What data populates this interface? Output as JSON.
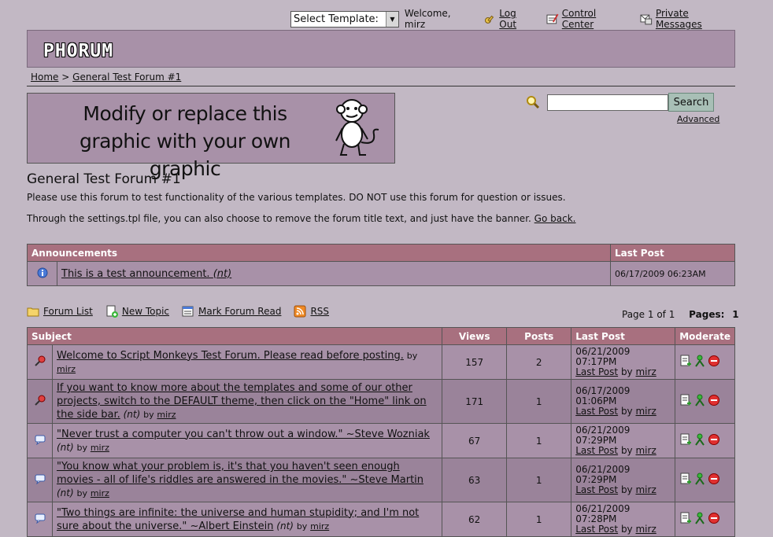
{
  "userbar": {
    "template_select": "Select Template:",
    "welcome": "Welcome, mirz",
    "logout": "Log Out",
    "control_center": "Control Center",
    "private_messages": "Private Messages"
  },
  "header": {
    "logo": "PHORUM"
  },
  "breadcrumb": {
    "home": "Home",
    "sep": ">",
    "forum": "General Test Forum #1"
  },
  "banner": {
    "line1": "Modify or replace this",
    "line2": "graphic with your own graphic"
  },
  "search": {
    "button": "Search",
    "advanced": "Advanced",
    "value": ""
  },
  "forum": {
    "title": "General Test Forum #1",
    "description": "Please use this forum to test functionality of the various templates. DO NOT use this forum for question or issues.",
    "note": "Through the settings.tpl file, you can also choose to remove the forum title text, and just have the banner.",
    "go_back": "Go back."
  },
  "announcements": {
    "headers": {
      "title": "Announcements",
      "last_post": "Last Post"
    },
    "items": [
      {
        "subject": "This is a test announcement.",
        "nt": "(nt)",
        "last_post": "06/17/2009 06:23AM"
      }
    ]
  },
  "toolbar": {
    "forum_list": "Forum List",
    "new_topic": "New Topic",
    "mark_read": "Mark Forum Read",
    "rss": "RSS"
  },
  "pager": {
    "page_of": "Page 1 of 1",
    "pages_label": "Pages:",
    "current": "1"
  },
  "messages": {
    "headers": {
      "subject": "Subject",
      "views": "Views",
      "posts": "Posts",
      "last_post": "Last Post",
      "moderate": "Moderate"
    },
    "by_label": "by",
    "last_post_link": "Last Post",
    "rows": [
      {
        "icon": "sticky-pin-icon",
        "subject": "Welcome to Script Monkeys Test Forum. Please read before posting.",
        "nt": "",
        "author": "mirz",
        "views": "157",
        "posts": "2",
        "date": "06/21/2009 07:17PM",
        "last_author": "mirz"
      },
      {
        "icon": "sticky-pin-icon",
        "subject": "If you want to know more about the templates and some of our other projects, switch to the DEFAULT theme, then click on the \"Home\" link on the side bar.",
        "nt": "(nt)",
        "author": "mirz",
        "views": "171",
        "posts": "1",
        "date": "06/17/2009 01:06PM",
        "last_author": "mirz"
      },
      {
        "icon": "speech-bubble-icon",
        "subject": "\"Never trust a computer you can't throw out a window.\" ~Steve Wozniak",
        "nt": "(nt)",
        "author": "mirz",
        "views": "67",
        "posts": "1",
        "date": "06/21/2009 07:29PM",
        "last_author": "mirz"
      },
      {
        "icon": "speech-bubble-icon",
        "subject": "\"You know what your problem is, it's that you haven't seen enough movies - all of life's riddles are answered in the movies.\" ~Steve Martin",
        "nt": "(nt)",
        "author": "mirz",
        "views": "63",
        "posts": "1",
        "date": "06/21/2009 07:29PM",
        "last_author": "mirz"
      },
      {
        "icon": "speech-bubble-icon",
        "subject": "\"Two things are infinite: the universe and human stupidity; and I'm not sure about the universe.\" ~Albert Einstein",
        "nt": "(nt)",
        "author": "mirz",
        "views": "62",
        "posts": "1",
        "date": "06/21/2009 07:28PM",
        "last_author": "mirz"
      }
    ]
  }
}
